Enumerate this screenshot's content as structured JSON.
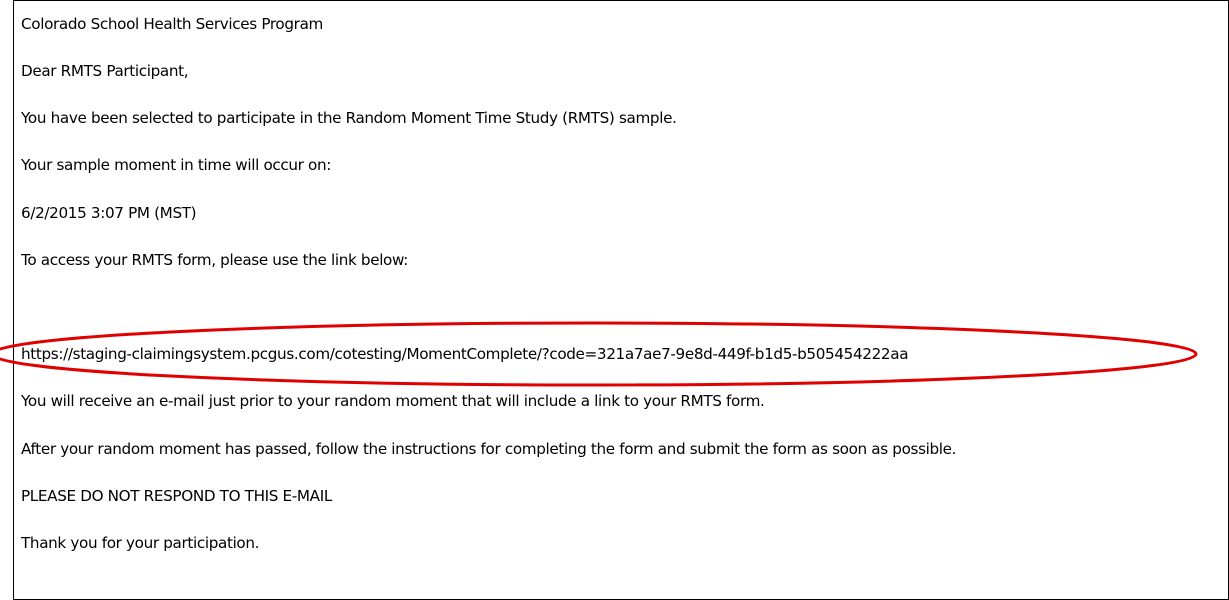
{
  "email": {
    "program_name": "Colorado School Health Services Program",
    "greeting": "Dear RMTS Participant,",
    "selection_notice": "You have been selected to participate in the Random Moment Time Study (RMTS) sample.",
    "moment_intro": "Your sample moment in time will occur on:",
    "moment_datetime": "6/2/2015 3:07 PM (MST)",
    "access_instructions": "To access your RMTS form, please use the link below:",
    "form_link": "https://staging-claimingsystem.pcgus.com/cotesting/MomentComplete/?code=321a7ae7-9e8d-449f-b1d5-b505454222aa",
    "reminder_notice": "You will receive an e-mail just prior to your random moment that will include a link to your RMTS form.",
    "completion_instructions": "After your random moment has passed, follow the instructions for completing the form and submit the form as soon as possible.",
    "no_reply_warning": "PLEASE DO NOT RESPOND TO THIS E-MAIL",
    "closing": "Thank you for your participation."
  },
  "annotation": {
    "ellipse_color": "#e00000"
  }
}
